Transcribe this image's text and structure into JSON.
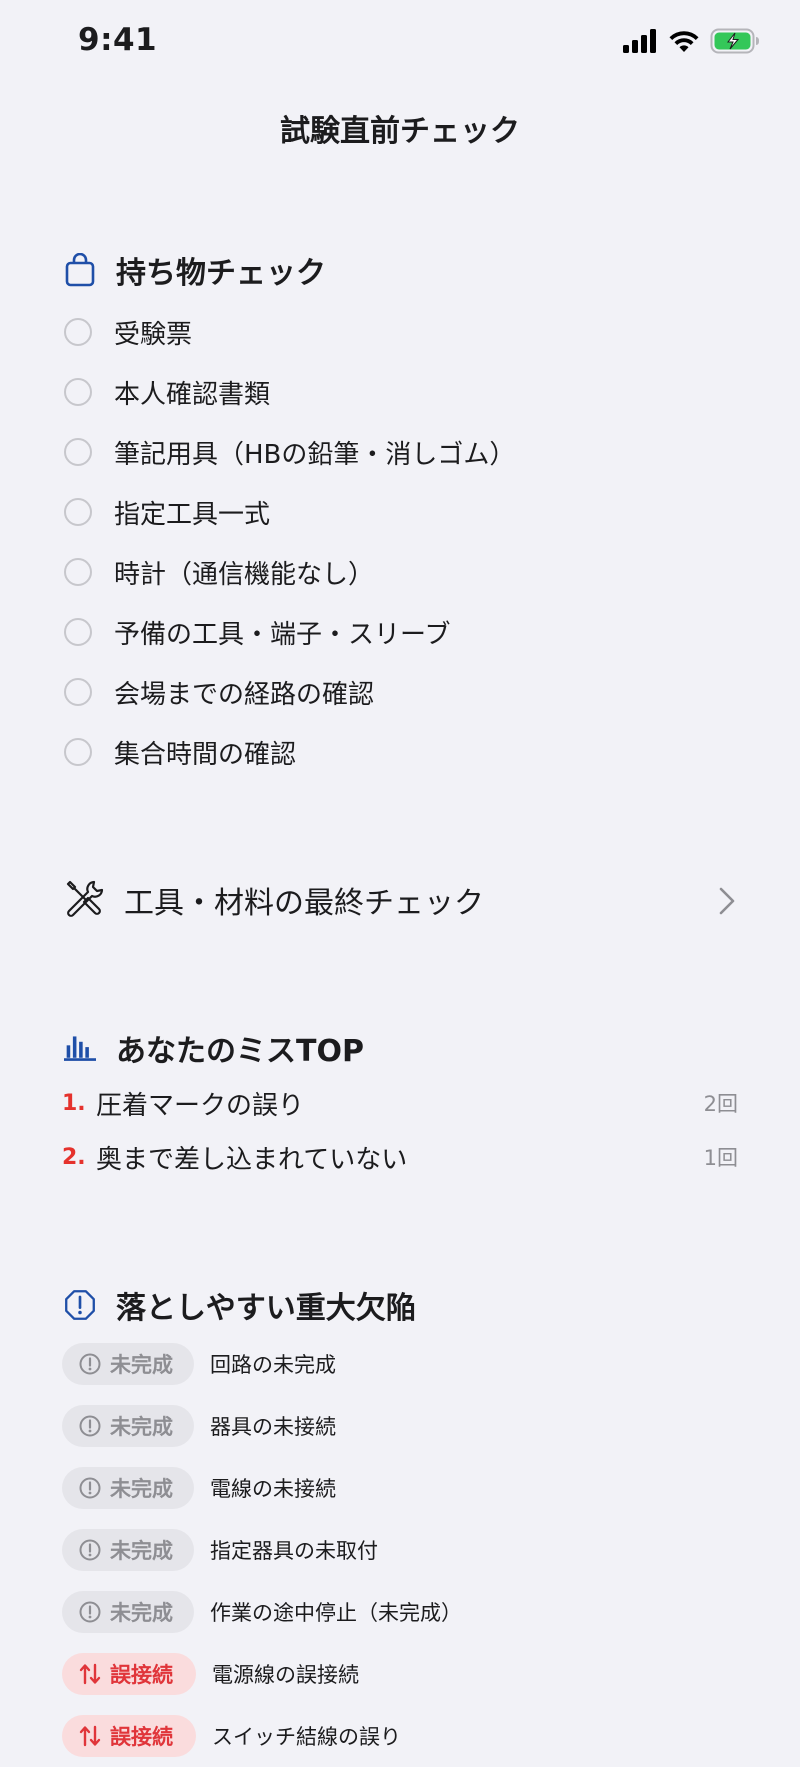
{
  "status_bar": {
    "time": "9:41"
  },
  "nav": {
    "title": "試験直前チェック"
  },
  "belongings": {
    "title": "持ち物チェック",
    "icon": "bag-icon",
    "items": [
      {
        "label": "受験票",
        "checked": false
      },
      {
        "label": "本人確認書類",
        "checked": false
      },
      {
        "label": "筆記用具（HBの鉛筆・消しゴム）",
        "checked": false
      },
      {
        "label": "指定工具一式",
        "checked": false
      },
      {
        "label": "時計（通信機能なし）",
        "checked": false
      },
      {
        "label": "予備の工具・端子・スリーブ",
        "checked": false
      },
      {
        "label": "会場までの経路の確認",
        "checked": false
      },
      {
        "label": "集合時間の確認",
        "checked": false
      }
    ]
  },
  "tools_link": {
    "label": "工具・材料の最終チェック",
    "icon": "tools-icon"
  },
  "mistakes": {
    "title": "あなたのミスTOP",
    "icon": "bar-chart-icon",
    "items": [
      {
        "rank": "1.",
        "label": "圧着マークの誤り",
        "count": "2回"
      },
      {
        "rank": "2.",
        "label": "奥まで差し込まれていない",
        "count": "1回"
      }
    ]
  },
  "defects": {
    "title": "落としやすい重大欠陥",
    "icon": "alert-octagon-icon",
    "items": [
      {
        "badge": "未完成",
        "type": "incomplete",
        "label": "回路の未完成"
      },
      {
        "badge": "未完成",
        "type": "incomplete",
        "label": "器具の未接続"
      },
      {
        "badge": "未完成",
        "type": "incomplete",
        "label": "電線の未接続"
      },
      {
        "badge": "未完成",
        "type": "incomplete",
        "label": "指定器具の未取付"
      },
      {
        "badge": "未完成",
        "type": "incomplete",
        "label": "作業の途中停止（未完成）"
      },
      {
        "badge": "誤接続",
        "type": "misconnect",
        "label": "電源線の誤接続"
      },
      {
        "badge": "誤接続",
        "type": "misconnect",
        "label": "スイッチ結線の誤り"
      }
    ]
  },
  "colors": {
    "accent_blue": "#1f4fa8",
    "danger_red": "#e0353a",
    "battery_green": "#34c759",
    "background": "#f2f2f7"
  }
}
